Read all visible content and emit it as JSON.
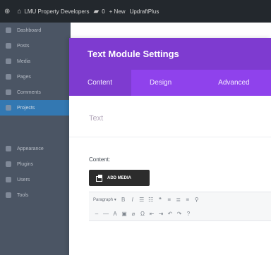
{
  "admin_bar": {
    "wp_icon": "wordpress-logo-icon",
    "site_icon": "home-icon",
    "site_name": "LMU Property Developers",
    "comments_icon": "comment-bubble-icon",
    "comments_count": "0",
    "new_label": "+ New",
    "plugin_label": "UpdraftPlus"
  },
  "sidebar": {
    "items": [
      {
        "label": "Dashboard"
      },
      {
        "label": "Posts"
      },
      {
        "label": "Media"
      },
      {
        "label": "Pages"
      },
      {
        "label": "Comments"
      },
      {
        "label": "Projects"
      },
      {
        "label": ""
      },
      {
        "label": "Appearance"
      },
      {
        "label": "Plugins"
      },
      {
        "label": "Users"
      },
      {
        "label": "Tools"
      }
    ]
  },
  "modal": {
    "title": "Text Module Settings",
    "tabs": [
      {
        "label": "Content"
      },
      {
        "label": "Design"
      },
      {
        "label": "Advanced"
      }
    ],
    "section_title": "Text",
    "content_label": "Content:",
    "add_media_label": "ADD MEDIA",
    "paragraph_select": "Paragraph"
  },
  "colors": {
    "header": "#7e3bd0",
    "tabs": "#8f42ec",
    "admin_bar": "#23282d",
    "sidebar": "#4b5564",
    "sidebar_active": "#2f7fc0"
  }
}
